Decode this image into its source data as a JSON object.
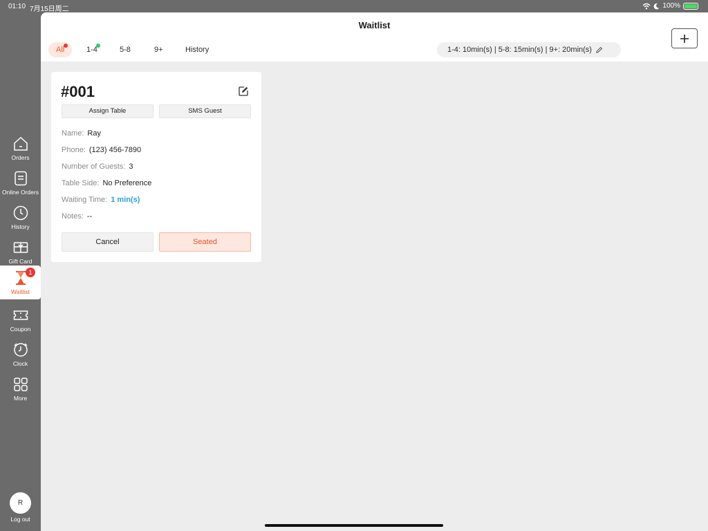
{
  "status_bar": {
    "time": "01:10",
    "date": "7月15日周二",
    "battery": "100%"
  },
  "sidebar": {
    "items": [
      {
        "label": "Orders",
        "icon": "home-icon"
      },
      {
        "label": "Online Orders",
        "icon": "document-icon"
      },
      {
        "label": "History",
        "icon": "clock-icon"
      },
      {
        "label": "Gift Card",
        "icon": "gift-card-icon"
      },
      {
        "label": "Waitlist",
        "icon": "hourglass-icon",
        "active": true,
        "badge": "1"
      },
      {
        "label": "Coupon",
        "icon": "ticket-icon"
      },
      {
        "label": "Clock",
        "icon": "alarm-clock-icon"
      },
      {
        "label": "More",
        "icon": "grid-icon"
      }
    ],
    "avatar_initial": "R",
    "logout_label": "Log out"
  },
  "header": {
    "title": "Waitlist",
    "tabs": [
      {
        "label": "All",
        "active": true,
        "dot_color": "#e53935"
      },
      {
        "label": "1-4",
        "dot_color": "#2ecc71"
      },
      {
        "label": "5-8"
      },
      {
        "label": "9+"
      },
      {
        "label": "History"
      }
    ],
    "wait_times": "1-4: 10min(s) | 5-8: 15min(s) | 9+: 20min(s)"
  },
  "card": {
    "number": "#001",
    "assign_label": "Assign Table",
    "sms_label": "SMS Guest",
    "fields": {
      "name": {
        "label": "Name:",
        "value": "Ray"
      },
      "phone": {
        "label": "Phone:",
        "value": "(123) 456-7890"
      },
      "guests": {
        "label": "Number of Guests:",
        "value": "3"
      },
      "side": {
        "label": "Table Side:",
        "value": "No Preference"
      },
      "waiting": {
        "label": "Waiting Time:",
        "value": "1 min(s)"
      },
      "notes": {
        "label": "Notes:",
        "value": "--"
      }
    },
    "cancel_label": "Cancel",
    "seated_label": "Seated"
  },
  "colors": {
    "accent": "#e8562b",
    "accent_bg": "#fde7df",
    "link_blue": "#2a9fd8",
    "sidebar": "#6b6b6b"
  }
}
